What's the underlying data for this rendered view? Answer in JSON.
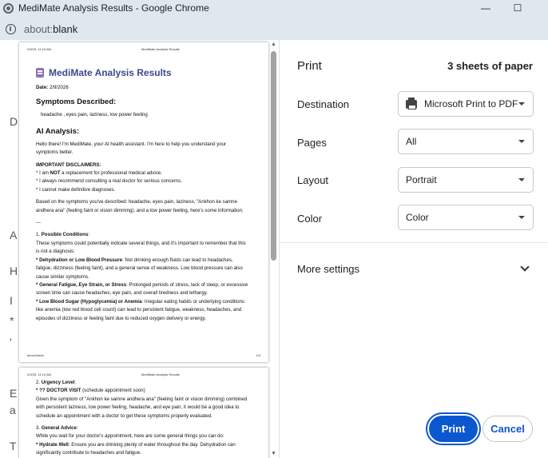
{
  "window": {
    "title": "MediMate Analysis Results - Google Chrome",
    "minimize": "—",
    "maximize": "☐"
  },
  "address": {
    "scheme": "about:",
    "path": "blank"
  },
  "background_page": {
    "glyphs": [
      "D",
      "A",
      "H",
      "I",
      "*",
      "'",
      "E",
      "a",
      "T"
    ]
  },
  "preview": {
    "sheet1": {
      "header_left": "2/9/26, 11:10 AM",
      "header_center": "MediMate Analysis Results",
      "title": "MediMate Analysis Results",
      "date_label": "Date:",
      "date": "2/9/2026",
      "symptoms_heading": "Symptoms Described:",
      "symptoms": "headache , eyes pain, laziness, low power feeling",
      "ai_heading": "AI Analysis:",
      "intro1": "Hello there! I'm MediMate, your AI health assistant. I'm here to help you understand your",
      "intro2": "symptoms better.",
      "disclaimers_heading": "IMPORTANT DISCLAIMERS:",
      "disc1_a": "* I am ",
      "disc1_b": "NOT",
      "disc1_c": " a replacement for professional medical advice.",
      "disc2": "* I always recommend consulting a real doctor for serious concerns.",
      "disc3": "* I cannot make definitive diagnoses.",
      "based1": "Based on the symptoms you've described: headache, eyes pain, laziness, \"Ankhon ke samne",
      "based2": "andhera ana\" (feeling faint or vision dimming), and a low power feeling, here's some information:",
      "rule": "---",
      "cond_num": "1. ",
      "cond_heading": "Possible Conditions",
      "cond_colon": ":",
      "cond1": "These symptoms could potentially indicate several things, and it's important to remember that this",
      "cond2": "is not a diagnosis:",
      "dehyd_b": "* Dehydration or Low Blood Pressure",
      "dehyd1": ": Not drinking enough fluids can lead to headaches,",
      "dehyd2": "fatigue, dizziness (feeling faint), and a general sense of weakness. Low blood pressure can also",
      "dehyd3": "cause similar symptoms.",
      "fat_b": "* General Fatigue, Eye Strain, or Stress",
      "fat1": ": Prolonged periods of stress, lack of sleep, or excessive",
      "fat2": "screen time can cause headaches, eye pain, and overall tiredness and lethargy.",
      "sugar_b": "* Low Blood Sugar (Hypoglycemia) or Anemia",
      "sugar1": ": Irregular eating habits or underlying conditions",
      "sugar2": "like anemia (low red blood cell count) can lead to persistent fatigue, weakness, headaches, and",
      "sugar3": "episodes of dizziness or feeling faint due to reduced oxygen delivery or energy.",
      "footer_left": "about:blank",
      "footer_right": "1/3"
    },
    "sheet2": {
      "header_left": "2/9/26, 11:10 AM",
      "header_center": "MediMate Analysis Results",
      "urg_num": "2. ",
      "urg_heading": "Urgency Level",
      "urg_colon": ":",
      "visit_b": "* ?? DOCTOR VISIT",
      "visit": " (schedule appointment soon)",
      "given1": "Given the symptom of \"Ankhon ke samne andhera ana\" (feeling faint or vision dimming) combined",
      "given2": "with persistent laziness, low power feeling, headache, and eye pain, it would be a good idea to",
      "given3": "schedule an appointment with a doctor to get these symptoms properly evaluated.",
      "adv_num": "3. ",
      "adv_heading": "General Advice",
      "adv_colon": ":",
      "adv1": "While you wait for your doctor's appointment, here are some general things you can do:",
      "hyd_b": "* Hydrate Well",
      "hyd1": ": Ensure you are drinking plenty of water throughout the day. Dehydration can",
      "hyd2": "significantly contribute to headaches and fatigue."
    }
  },
  "print_panel": {
    "title": "Print",
    "sheets": "3 sheets of paper",
    "destination_label": "Destination",
    "destination_value": "Microsoft Print to PDF",
    "pages_label": "Pages",
    "pages_value": "All",
    "layout_label": "Layout",
    "layout_value": "Portrait",
    "color_label": "Color",
    "color_value": "Color",
    "more_settings": "More settings",
    "print_button": "Print",
    "cancel_button": "Cancel"
  },
  "colors": {
    "accent": "#0b57d0",
    "title_bar": "#dfe8ee",
    "doc_title": "#3b4a8c"
  }
}
